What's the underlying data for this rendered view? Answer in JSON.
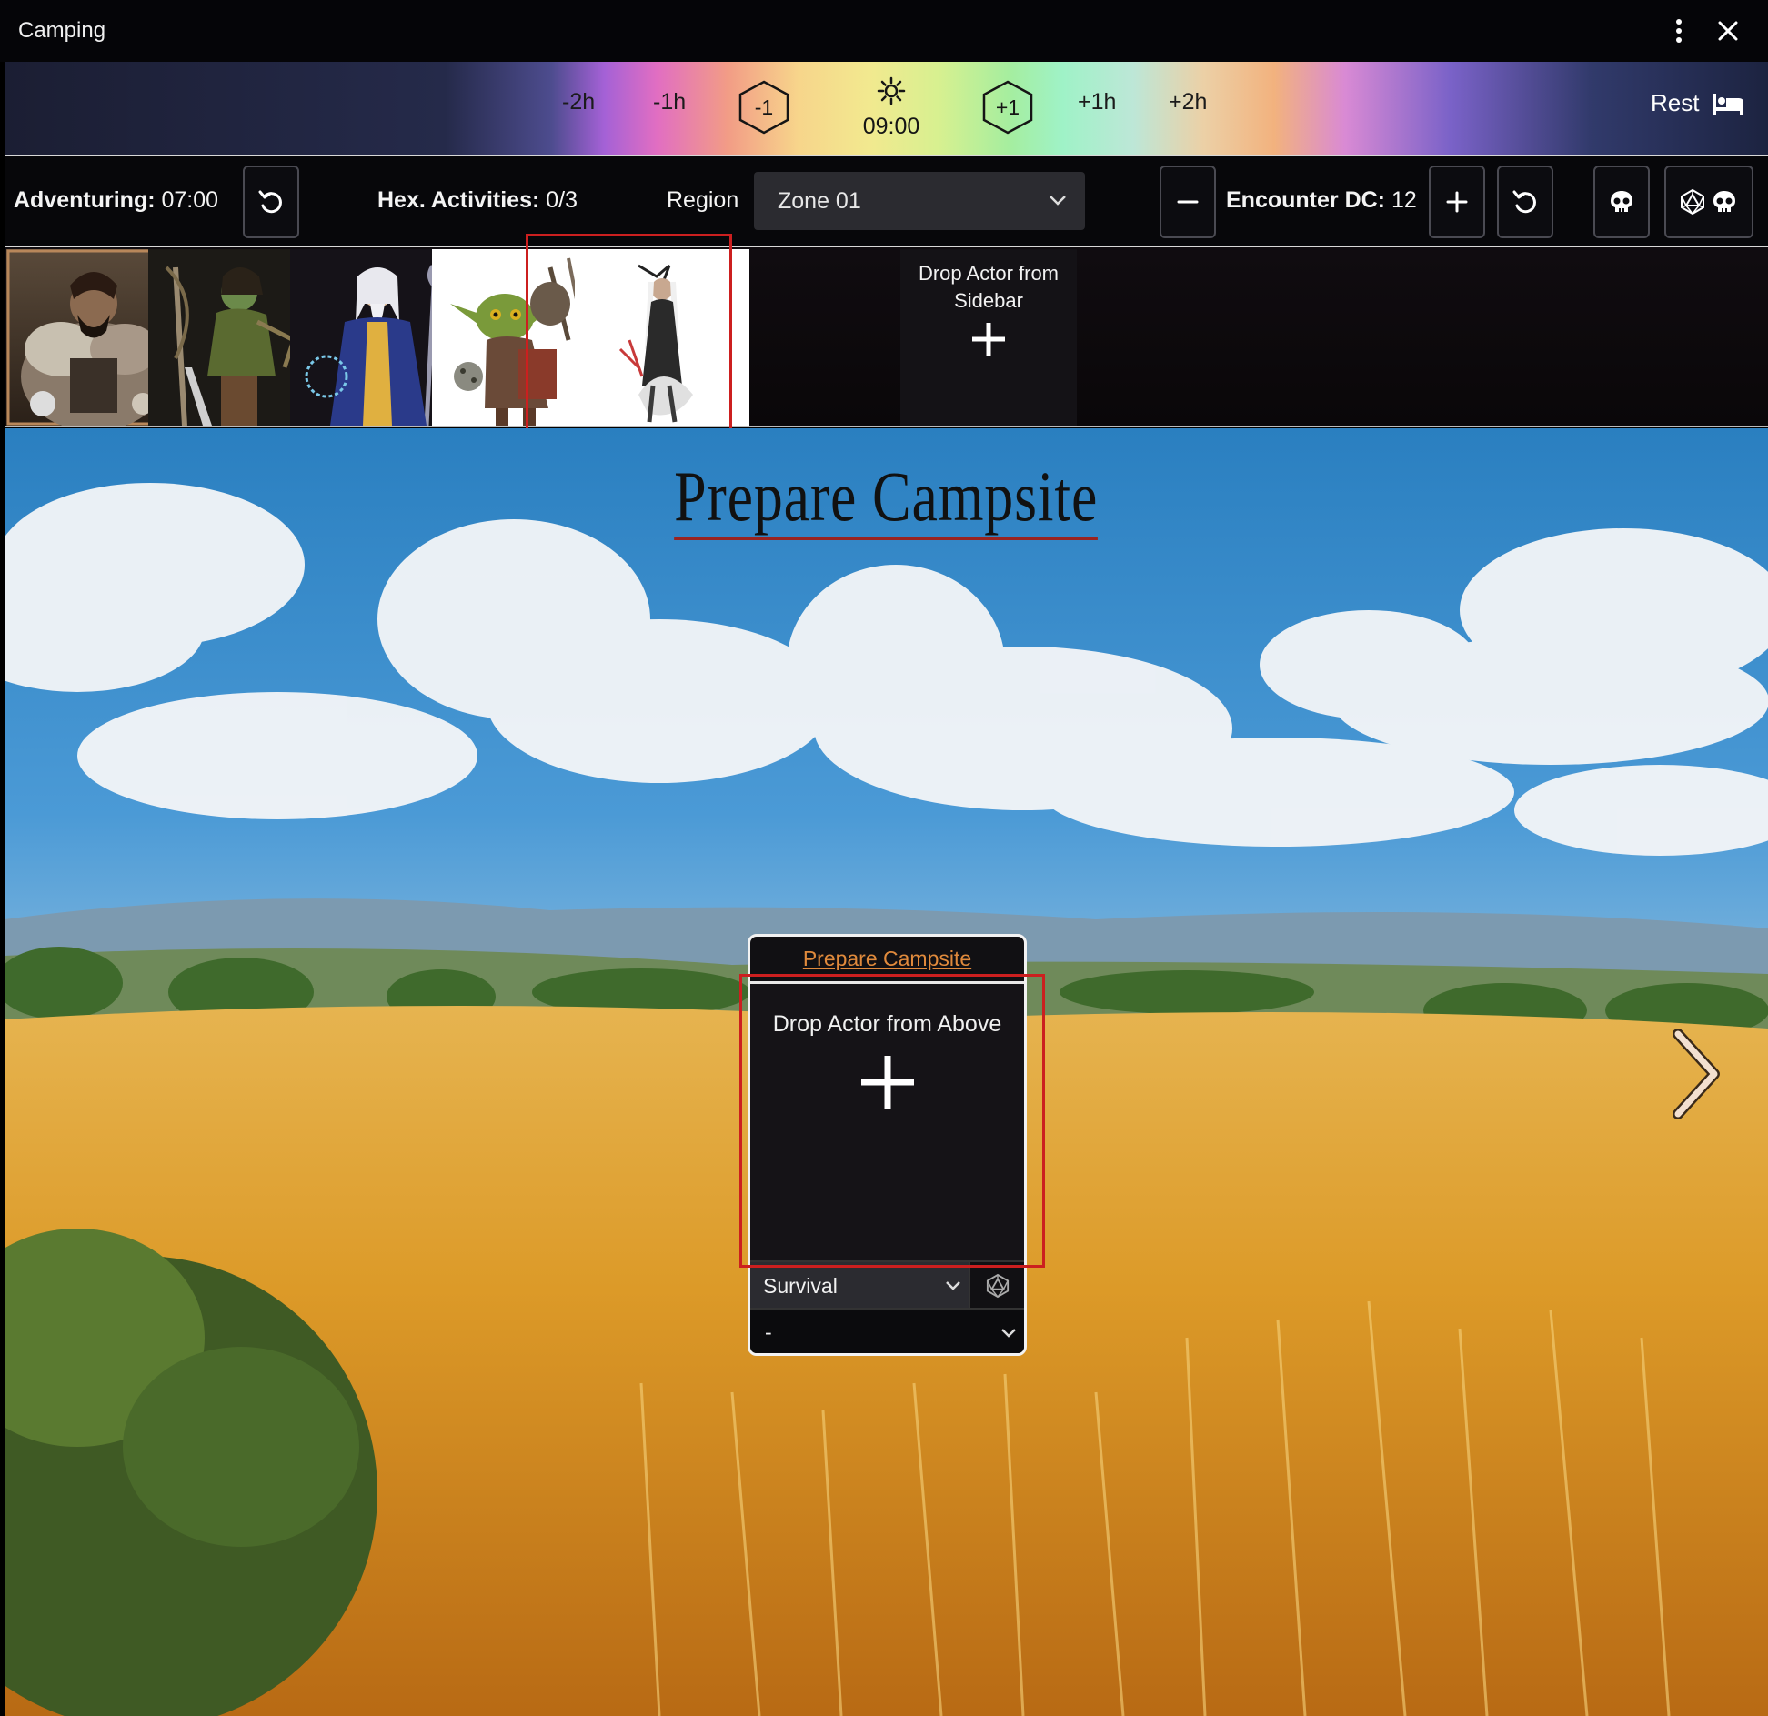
{
  "window": {
    "title": "Camping"
  },
  "timebar": {
    "minus2h": "-2h",
    "minus1h": "-1h",
    "minus1": "-1",
    "time": "09:00",
    "plus1": "+1",
    "plus1h": "+1h",
    "plus2h": "+2h",
    "rest_label": "Rest"
  },
  "controls": {
    "adventuring_label": "Adventuring:",
    "adventuring_value": "07:00",
    "hex_label": "Hex. Activities:",
    "hex_value": "0/3",
    "region_label": "Region",
    "region_value": "Zone 01",
    "encounter_label": "Encounter DC:",
    "encounter_value": "12"
  },
  "actors": [
    {
      "name": "actor-barbarian"
    },
    {
      "name": "actor-ranger"
    },
    {
      "name": "actor-wizard"
    },
    {
      "name": "actor-goblin"
    },
    {
      "name": "actor-shaman"
    }
  ],
  "drop_sidebar": {
    "text": "Drop Actor from Sidebar"
  },
  "scene": {
    "title": "Prepare Campsite",
    "card": {
      "heading": "Prepare Campsite",
      "drop_text": "Drop Actor from Above",
      "skill_value": "Survival",
      "actor_value": "-"
    }
  },
  "colors": {
    "accent_orange": "#e08a3c",
    "highlight_red": "#cc1f1f",
    "panel_dark": "#07070a"
  }
}
